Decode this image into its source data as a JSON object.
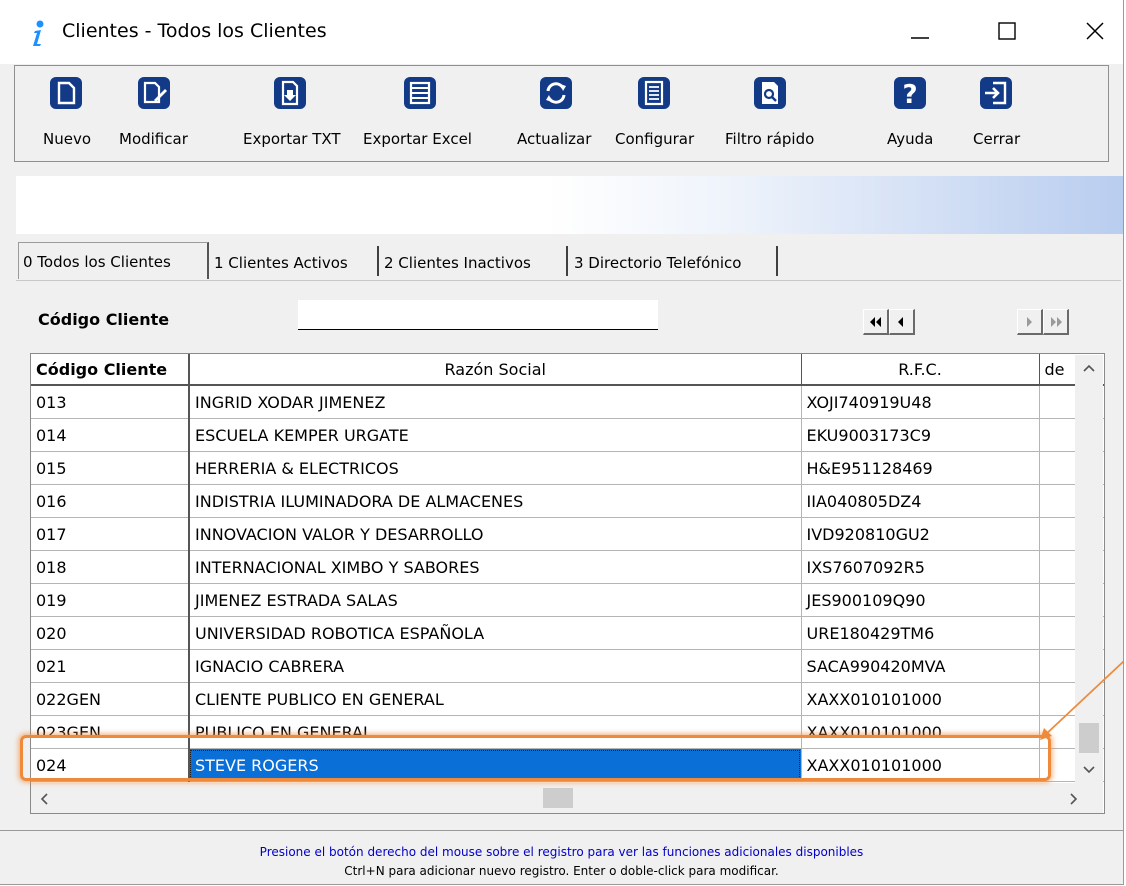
{
  "window": {
    "title": "Clientes - Todos los Clientes"
  },
  "toolbar": [
    {
      "label": "Nuevo",
      "icon": "new-document-icon"
    },
    {
      "label": "Modificar",
      "icon": "edit-document-icon"
    },
    {
      "label": "Exportar TXT",
      "icon": "export-txt-icon"
    },
    {
      "label": "Exportar Excel",
      "icon": "export-excel-icon"
    },
    {
      "label": "Actualizar",
      "icon": "refresh-icon"
    },
    {
      "label": "Configurar",
      "icon": "configure-icon"
    },
    {
      "label": "Filtro rápido",
      "icon": "quick-filter-icon"
    },
    {
      "label": "Ayuda",
      "icon": "help-icon"
    },
    {
      "label": "Cerrar",
      "icon": "exit-icon"
    }
  ],
  "tabs": [
    {
      "label": "0 Todos los Clientes",
      "selected": true
    },
    {
      "label": "1 Clientes Activos",
      "selected": false
    },
    {
      "label": "2 Clientes Inactivos",
      "selected": false
    },
    {
      "label": "3 Directorio Telefónico",
      "selected": false
    }
  ],
  "search": {
    "label": "Código Cliente",
    "value": ""
  },
  "grid": {
    "columns": [
      "Código Cliente",
      "Razón Social",
      "R.F.C.",
      "de"
    ],
    "rows": [
      {
        "code": "013",
        "name": "INGRID XODAR JIMENEZ",
        "rfc": "XOJI740919U48"
      },
      {
        "code": "014",
        "name": "ESCUELA KEMPER URGATE",
        "rfc": "EKU9003173C9"
      },
      {
        "code": "015",
        "name": "HERRERIA & ELECTRICOS",
        "rfc": "H&E951128469"
      },
      {
        "code": "016",
        "name": "INDISTRIA ILUMINADORA DE ALMACENES",
        "rfc": "IIA040805DZ4"
      },
      {
        "code": "017",
        "name": "INNOVACION VALOR Y DESARROLLO",
        "rfc": "IVD920810GU2"
      },
      {
        "code": "018",
        "name": "INTERNACIONAL XIMBO Y SABORES",
        "rfc": "IXS7607092R5"
      },
      {
        "code": "019",
        "name": "JIMENEZ ESTRADA SALAS",
        "rfc": "JES900109Q90"
      },
      {
        "code": "020",
        "name": "UNIVERSIDAD ROBOTICA ESPAÑOLA",
        "rfc": "URE180429TM6"
      },
      {
        "code": "021",
        "name": "IGNACIO CABRERA",
        "rfc": "SACA990420MVA"
      },
      {
        "code": "022GEN",
        "name": "CLIENTE PUBLICO EN GENERAL",
        "rfc": "XAXX010101000"
      },
      {
        "code": "023GEN",
        "name": "PUBLICO EN GENERAL",
        "rfc": "XAXX010101000"
      },
      {
        "code": "024",
        "name": "STEVE ROGERS",
        "rfc": "XAXX010101000"
      }
    ],
    "selected_code": "024"
  },
  "status": {
    "line1": "Presione el botón derecho del mouse sobre el registro para ver las funciones adicionales disponibles",
    "line2": "Ctrl+N para adicionar nuevo registro. Enter o doble-click para modificar."
  },
  "colors": {
    "accent": "#0a6fd6",
    "highlight": "#ee8a3c",
    "status_text": "#0000c8"
  }
}
